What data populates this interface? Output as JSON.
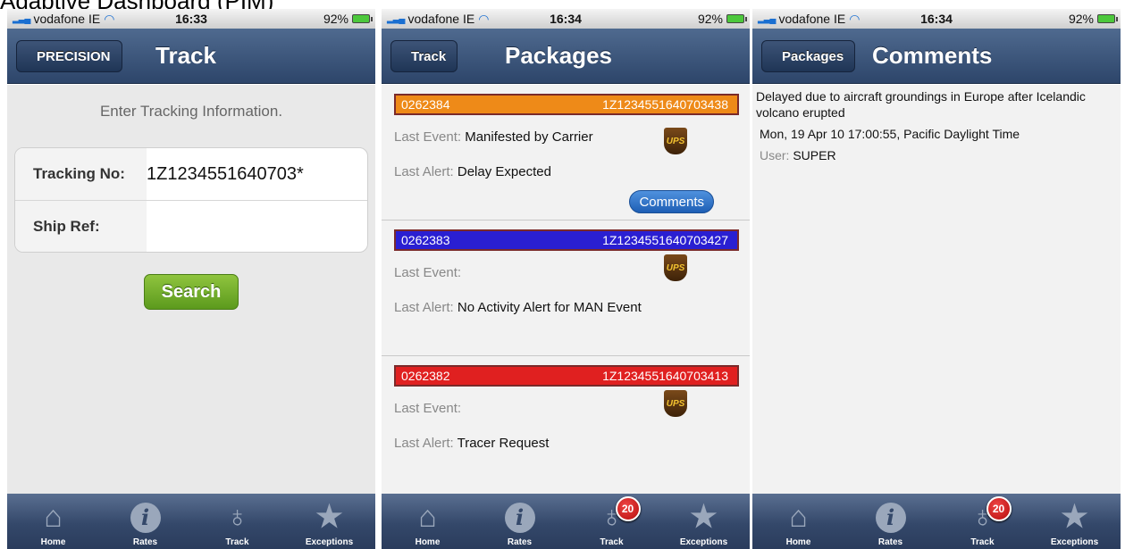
{
  "caption": "Adaptive Dashboard (PIM)",
  "status": {
    "carrier": "vodafone IE",
    "battery": "92%"
  },
  "screens": [
    {
      "time": "16:33",
      "title": "Track",
      "back": "PRECISION",
      "prompt": "Enter Tracking Information.",
      "form": {
        "tracking_label": "Tracking No:",
        "tracking_value": "1Z1234551640703*",
        "shipref_label": "Ship Ref:",
        "shipref_value": ""
      },
      "search_label": "Search"
    },
    {
      "time": "16:34",
      "title": "Packages",
      "back": "Track",
      "packages": [
        {
          "id": "0262384",
          "tracking": "1Z1234551640703438",
          "event_label": "Last Event:",
          "event": "Manifested by Carrier",
          "alert_label": "Last Alert:",
          "alert": "Delay Expected",
          "color": "#ee8a18",
          "comments": "Comments"
        },
        {
          "id": "0262383",
          "tracking": "1Z1234551640703427",
          "event_label": "Last Event:",
          "event": "",
          "alert_label": "Last Alert:",
          "alert": "No Activity Alert for MAN Event",
          "color": "#2a1fd2"
        },
        {
          "id": "0262382",
          "tracking": "1Z1234551640703413",
          "event_label": "Last Event:",
          "event": "",
          "alert_label": "Last Alert:",
          "alert": "Tracer Request",
          "color": "#e02020"
        }
      ],
      "carrier_logo": "UPS"
    },
    {
      "time": "16:34",
      "title": "Comments",
      "back": "Packages",
      "comment": "Delayed due to aircraft groundings in Europe after Icelandic volcano erupted",
      "date": "Mon, 19 Apr 10 17:00:55, Pacific Daylight Time",
      "user_label": "User:",
      "user": "SUPER"
    }
  ],
  "tabs": [
    {
      "label": "Home",
      "icon": "house-icon"
    },
    {
      "label": "Rates",
      "icon": "info-icon"
    },
    {
      "label": "Track",
      "icon": "joystick-icon"
    },
    {
      "label": "Exceptions",
      "icon": "star-icon"
    }
  ],
  "badge": "20"
}
